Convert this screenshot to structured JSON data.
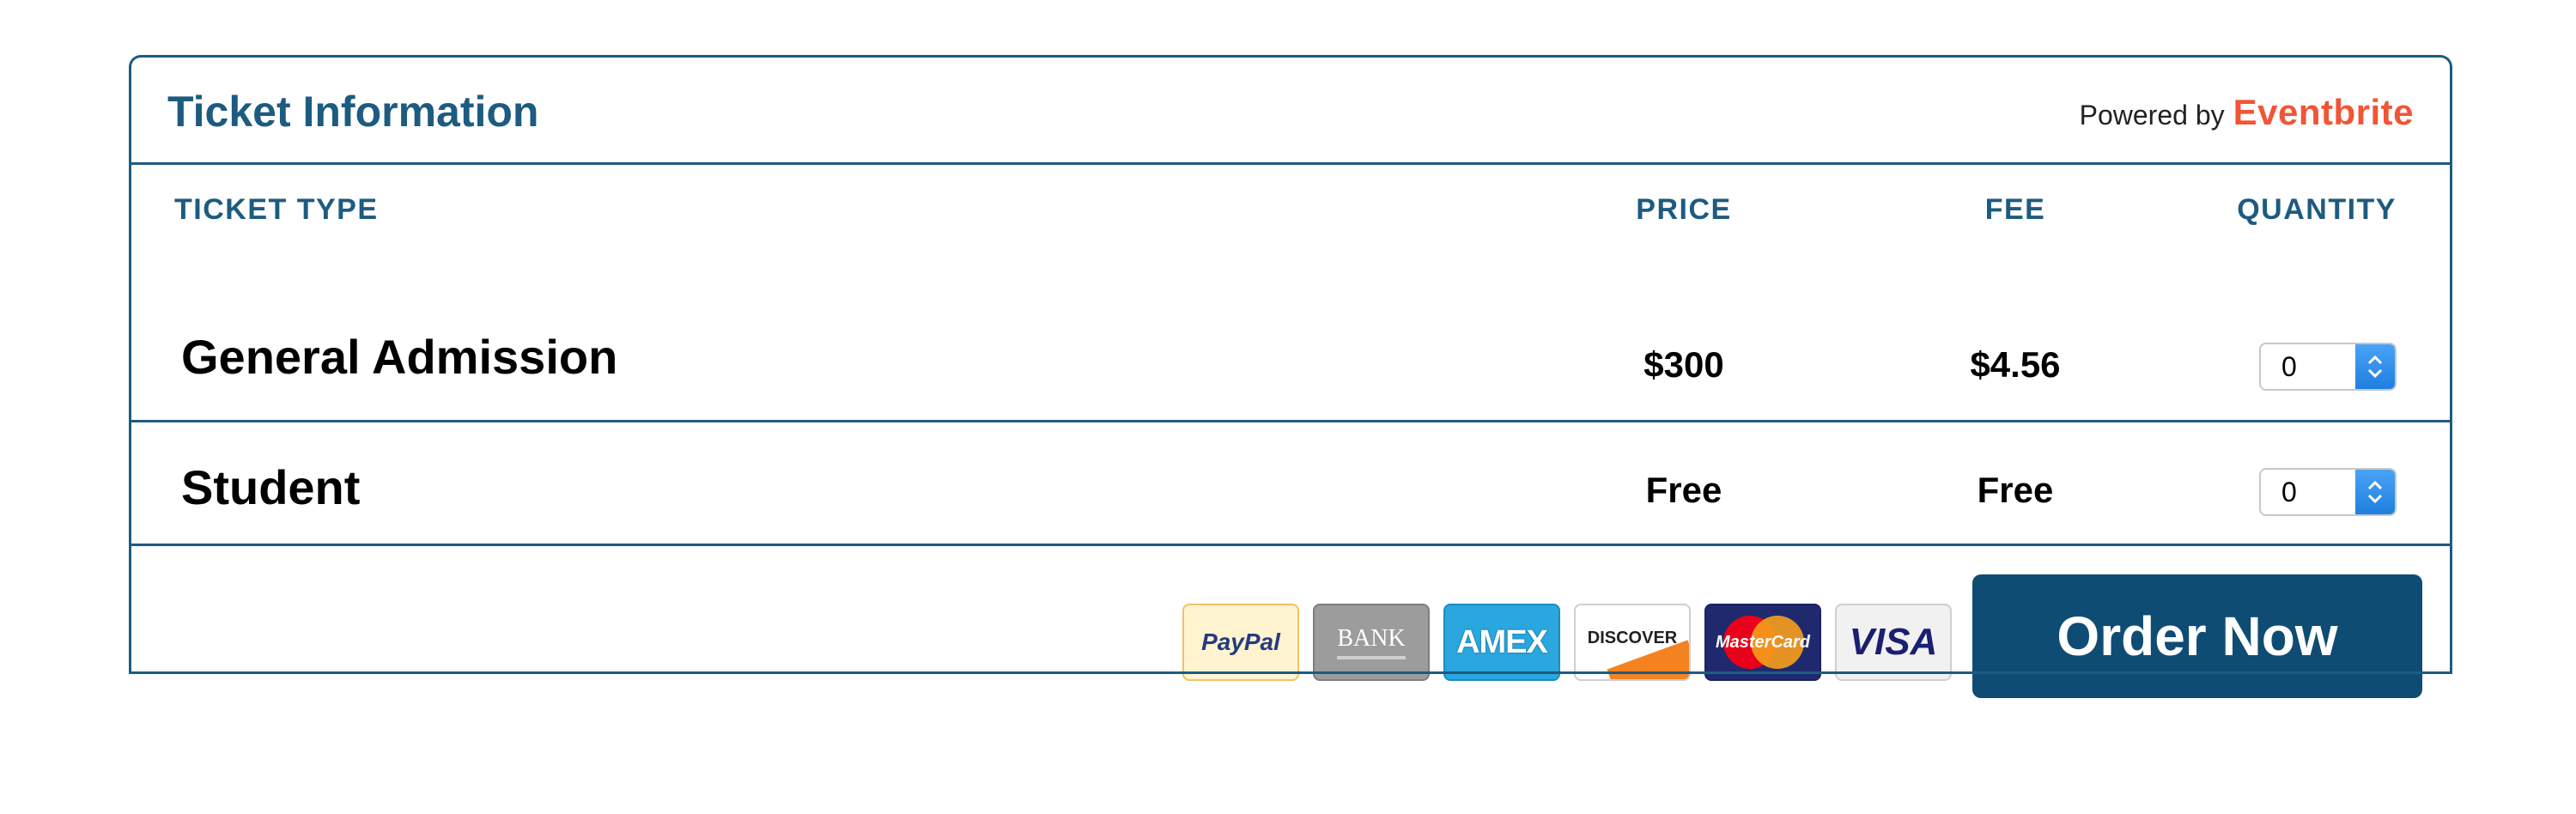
{
  "header": {
    "title": "Ticket Information",
    "powered_by": "Powered by",
    "brand": "Eventbrite"
  },
  "columns": {
    "ticket_type": "TICKET TYPE",
    "price": "PRICE",
    "fee": "FEE",
    "quantity": "QUANTITY"
  },
  "tickets": [
    {
      "name": "General Admission",
      "price": "$300",
      "fee": "$4.56",
      "quantity": "0"
    },
    {
      "name": "Student",
      "price": "Free",
      "fee": "Free",
      "quantity": "0"
    }
  ],
  "payment_methods": [
    {
      "name": "PayPal",
      "icon": "paypal-icon"
    },
    {
      "name": "BANK",
      "icon": "bank-icon"
    },
    {
      "name": "AMEX",
      "icon": "amex-icon"
    },
    {
      "name": "DISCOVER",
      "icon": "discover-icon"
    },
    {
      "name": "MasterCard",
      "icon": "mastercard-icon"
    },
    {
      "name": "VISA",
      "icon": "visa-icon"
    }
  ],
  "order_button": {
    "label": "Order Now"
  },
  "colors": {
    "primary": "#1d5b80",
    "button": "#0f4c74",
    "brand": "#f05537"
  }
}
